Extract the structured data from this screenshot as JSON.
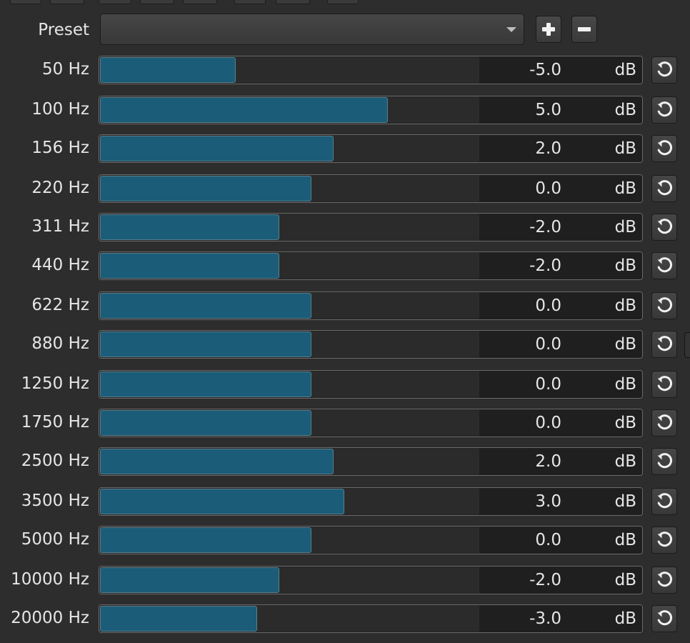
{
  "preset": {
    "label": "Preset",
    "value": "",
    "add_button": "add-preset",
    "remove_button": "remove-preset"
  },
  "bands": [
    {
      "label": "50 Hz",
      "value": "-5.0",
      "unit": "dB",
      "level": 0.25
    },
    {
      "label": "100 Hz",
      "value": "5.0",
      "unit": "dB",
      "level": 0.53
    },
    {
      "label": "156 Hz",
      "value": "2.0",
      "unit": "dB",
      "level": 0.43
    },
    {
      "label": "220 Hz",
      "value": "0.0",
      "unit": "dB",
      "level": 0.39
    },
    {
      "label": "311 Hz",
      "value": "-2.0",
      "unit": "dB",
      "level": 0.33
    },
    {
      "label": "440 Hz",
      "value": "-2.0",
      "unit": "dB",
      "level": 0.33
    },
    {
      "label": "622 Hz",
      "value": "0.0",
      "unit": "dB",
      "level": 0.39
    },
    {
      "label": "880 Hz",
      "value": "0.0",
      "unit": "dB",
      "level": 0.39
    },
    {
      "label": "1250 Hz",
      "value": "0.0",
      "unit": "dB",
      "level": 0.39
    },
    {
      "label": "1750 Hz",
      "value": "0.0",
      "unit": "dB",
      "level": 0.39
    },
    {
      "label": "2500 Hz",
      "value": "2.0",
      "unit": "dB",
      "level": 0.43
    },
    {
      "label": "3500 Hz",
      "value": "3.0",
      "unit": "dB",
      "level": 0.45
    },
    {
      "label": "5000 Hz",
      "value": "0.0",
      "unit": "dB",
      "level": 0.39
    },
    {
      "label": "10000 Hz",
      "value": "-2.0",
      "unit": "dB",
      "level": 0.33
    },
    {
      "label": "20000 Hz",
      "value": "-3.0",
      "unit": "dB",
      "level": 0.29
    }
  ],
  "colors": {
    "background": "#2d2d2d",
    "slider_fill": "#1b5c78",
    "value_box": "#1f1f1f"
  },
  "icons": {
    "reset": "reset-icon",
    "add": "plus-icon",
    "remove": "minus-icon",
    "dropdown": "chevron-down-icon"
  }
}
